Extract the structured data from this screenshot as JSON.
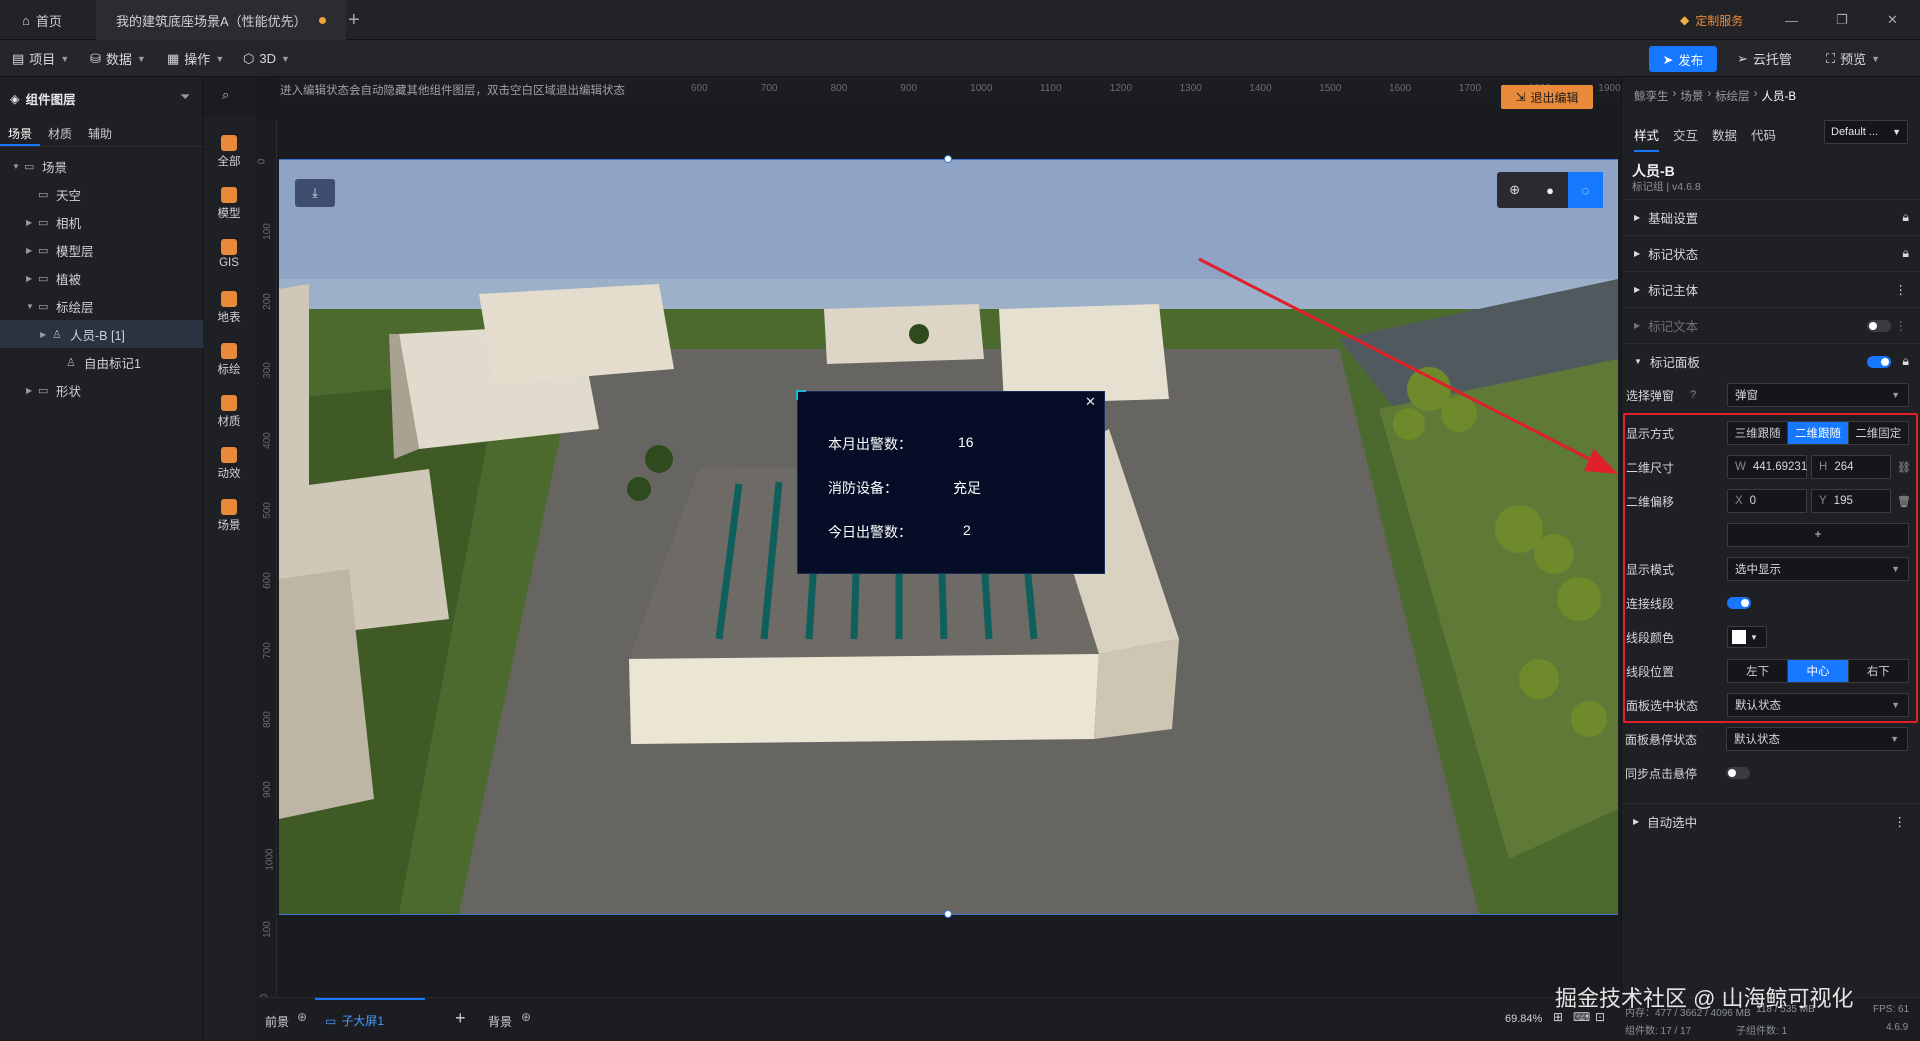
{
  "tabs": {
    "home": "首页",
    "active": "我的建筑底座场景A（性能优先）",
    "add": "+",
    "custom_service": "定制服务"
  },
  "window_controls": {
    "minimize": "—",
    "restore": "❐",
    "close": "✕"
  },
  "menu": {
    "project": "项目",
    "data": "数据",
    "operate": "操作",
    "mode3d": "3D",
    "publish": "发布",
    "cloud": "云托管",
    "preview": "预览"
  },
  "left_panel": {
    "title": "组件图层",
    "tabs": [
      "场景",
      "材质",
      "辅助"
    ],
    "tree": [
      {
        "label": "场景",
        "level": 0,
        "expanded": true
      },
      {
        "label": "天空",
        "level": 1
      },
      {
        "label": "相机",
        "level": 1
      },
      {
        "label": "模型层",
        "level": 1
      },
      {
        "label": "植被",
        "level": 1
      },
      {
        "label": "标绘层",
        "level": 1,
        "expanded": true
      },
      {
        "label": "人员-B [1]",
        "level": 2,
        "selected": true
      },
      {
        "label": "自由标记1",
        "level": 3
      },
      {
        "label": "形状",
        "level": 1
      }
    ]
  },
  "icon_bar": [
    "全部",
    "模型",
    "GIS",
    "地表",
    "标绘",
    "材质",
    "动效",
    "场景"
  ],
  "canvas": {
    "hint": "进入编辑状态会自动隐藏其他组件图层，双击空白区域退出编辑状态",
    "exit_button": "退出编辑",
    "ruler_top": [
      "600",
      "700",
      "800",
      "900",
      "1000",
      "1100",
      "1200",
      "1300",
      "1400",
      "1500",
      "1600",
      "1700",
      "1800",
      "1900"
    ],
    "ruler_left": [
      "0",
      "100",
      "200",
      "300",
      "400",
      "500",
      "600",
      "700",
      "800",
      "900",
      "1000",
      "100",
      "00"
    ]
  },
  "popup": {
    "rows": [
      {
        "label": "本月出警数：",
        "value": "16"
      },
      {
        "label": "消防设备：",
        "value": "充足"
      },
      {
        "label": "今日出警数：",
        "value": "2"
      }
    ],
    "close": "✕"
  },
  "right_panel": {
    "breadcrumb": [
      "鲸孪生",
      "场景",
      "标绘层",
      "人员-B"
    ],
    "tabs": [
      "样式",
      "交互",
      "数据",
      "代码"
    ],
    "preset": "Default ...",
    "title": "人员-B",
    "subtitle": "标记组 | v4.6.8",
    "sections": {
      "basic": "基础设置",
      "marker_state": "标记状态",
      "marker_body": "标记主体",
      "marker_text": "标记文本",
      "marker_panel": "标记面板",
      "auto_select": "自动选中"
    },
    "props": {
      "popup_select_label": "选择弹窗",
      "popup_select_value": "弹窗",
      "display_mode_label": "显示方式",
      "display_mode_options": [
        "三维跟随",
        "二维跟随",
        "二维固定"
      ],
      "display_mode_active": 1,
      "size_label": "二维尺寸",
      "w_prefix": "W",
      "w_value": "441.69231",
      "h_prefix": "H",
      "h_value": "264",
      "offset_label": "二维偏移",
      "x_prefix": "X",
      "x_value": "0",
      "y_prefix": "Y",
      "y_value": "195",
      "add": "+",
      "show_mode_label": "显示模式",
      "show_mode_value": "选中显示",
      "connect_line_label": "连接线段",
      "line_color_label": "线段颜色",
      "line_pos_label": "线段位置",
      "line_pos_options": [
        "左下",
        "中心",
        "右下"
      ],
      "line_pos_active": 1,
      "panel_selected_label": "面板选中状态",
      "panel_selected_value": "默认状态",
      "panel_hover_label": "面板悬停状态",
      "panel_hover_value": "默认状态",
      "sync_hover_label": "同步点击悬停"
    }
  },
  "bottom": {
    "front": "前景",
    "screen": "子大屏1",
    "add": "+",
    "back": "背景",
    "zoom": "69.84%",
    "stats1": "内存：477 / 3662 / 4096 MB",
    "gpu": "118 / 535 MB",
    "fps": "FPS: 61",
    "stats2": "组件数: 17 / 17",
    "children": "子组件数: 1",
    "version": "4.6.9"
  },
  "watermark": "掘金技术社区 @ 山海鲸可视化",
  "colors": {
    "accent": "#1677ff",
    "highlight": "#e0202a",
    "orange": "#e98a3a"
  }
}
